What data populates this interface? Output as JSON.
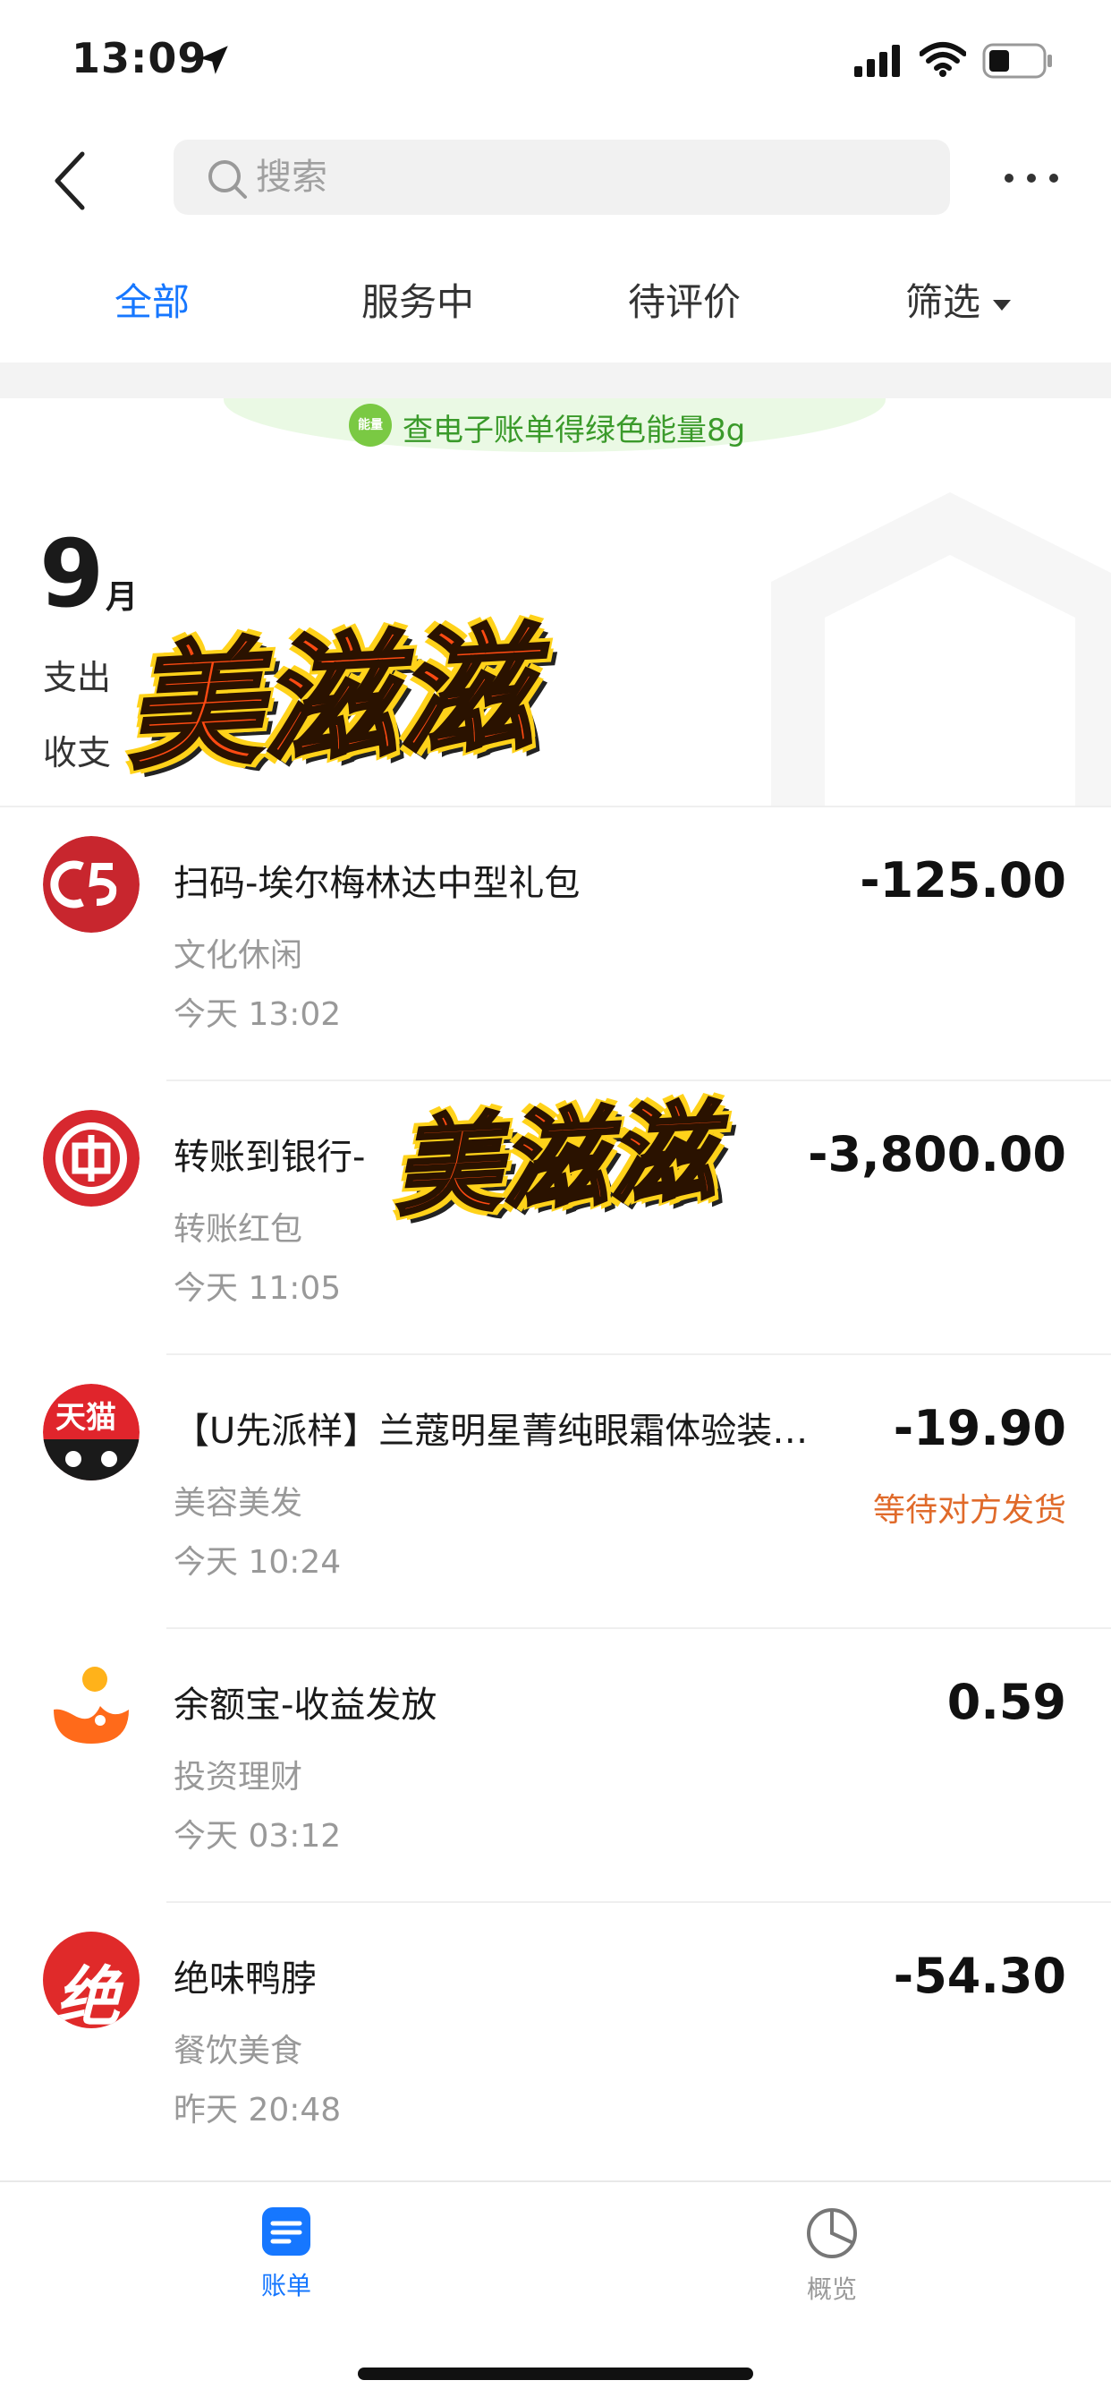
{
  "status_bar": {
    "time": "13:09"
  },
  "header": {
    "search_placeholder": "搜索"
  },
  "tabs": [
    {
      "label": "全部",
      "active": true
    },
    {
      "label": "服务中",
      "active": false
    },
    {
      "label": "待评价",
      "active": false
    },
    {
      "label": "筛选",
      "active": false
    }
  ],
  "energy_banner": {
    "badge": "能量",
    "text": "查电子账单得绿色能量8g"
  },
  "summary": {
    "month": "9",
    "month_unit": "月",
    "line1": "支出",
    "line2": "收支",
    "sticker": "美滋滋"
  },
  "transactions": [
    {
      "title": "扫码-埃尔梅林达中型礼包",
      "category": "文化休闲",
      "time": "今天  13:02",
      "amount": "-125.00",
      "status": "",
      "logo": "c5-logo",
      "logo_color": "#c8262e"
    },
    {
      "title": "转账到银行-",
      "category": "转账红包",
      "time": "今天  11:05",
      "amount": "-3,800.00",
      "status": "",
      "logo": "icbc-logo",
      "logo_color": "#d7282f"
    },
    {
      "title": "【U先派样】兰蔻明星菁纯眼霜体验装…",
      "category": "美容美发",
      "time": "今天  10:24",
      "amount": "-19.90",
      "status": "等待对方发货",
      "logo": "tmall-logo",
      "logo_text": "天猫",
      "logo_color": "#e0252c"
    },
    {
      "title": "余额宝-收益发放",
      "category": "投资理财",
      "time": "今天  03:12",
      "amount": "0.59",
      "status": "",
      "logo": "yuebao-logo",
      "logo_color": "#ff6a1a"
    },
    {
      "title": "绝味鸭脖",
      "category": "餐饮美食",
      "time": "昨天  20:48",
      "amount": "-54.30",
      "status": "",
      "logo": "juewei-logo",
      "logo_text": "绝",
      "logo_color": "#e02a2a"
    }
  ],
  "bottom_nav": [
    {
      "label": "账单",
      "active": true
    },
    {
      "label": "概览",
      "active": false
    }
  ],
  "colors": {
    "accent": "#1677ff",
    "status_orange": "#e06a2a",
    "energy_green": "#3a9a2a"
  }
}
